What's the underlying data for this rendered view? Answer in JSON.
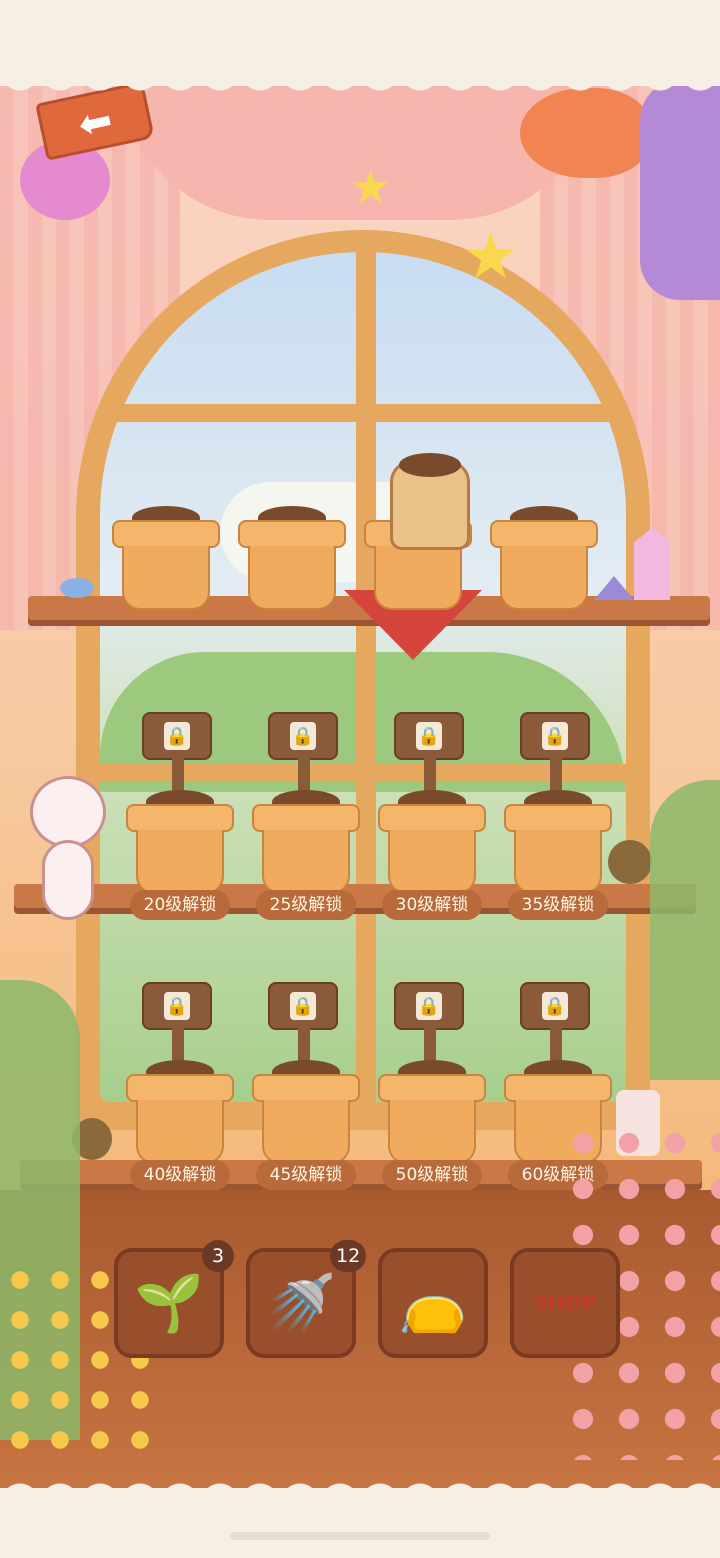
{
  "colors": {
    "wall": "#fbd6c9",
    "frame": "#e6a75f",
    "shelf": "#c97846",
    "label_bg": "#b86a3a",
    "back_button": "#e0683d",
    "tool_bg": "#9a4f2c"
  },
  "header": {
    "back_icon": "arrow-left-icon",
    "back_glyph": "⬅"
  },
  "shelf_top": {
    "pots": [
      {
        "state": "planted_seed_bag"
      },
      {
        "state": "empty"
      },
      {
        "state": "seed_bag"
      },
      {
        "state": "empty"
      }
    ]
  },
  "locked_rows": [
    {
      "labels": [
        "20级解锁",
        "25级解锁",
        "30级解锁",
        "35级解锁"
      ]
    },
    {
      "labels": [
        "40级解锁",
        "45级解锁",
        "50级解锁",
        "60级解锁"
      ]
    }
  ],
  "toolbar": {
    "items": [
      {
        "name": "seed-bag",
        "icon": "seed-bag-icon",
        "glyph": "🌱",
        "badge": "3"
      },
      {
        "name": "watering-can",
        "icon": "watering-can-icon",
        "glyph": "🚿",
        "badge": "12"
      },
      {
        "name": "gift-pouch",
        "icon": "pouch-icon",
        "glyph": "👝",
        "badge": ""
      },
      {
        "name": "shop",
        "icon": "shop-bag-icon",
        "glyph": "SHOP",
        "badge": ""
      }
    ]
  }
}
